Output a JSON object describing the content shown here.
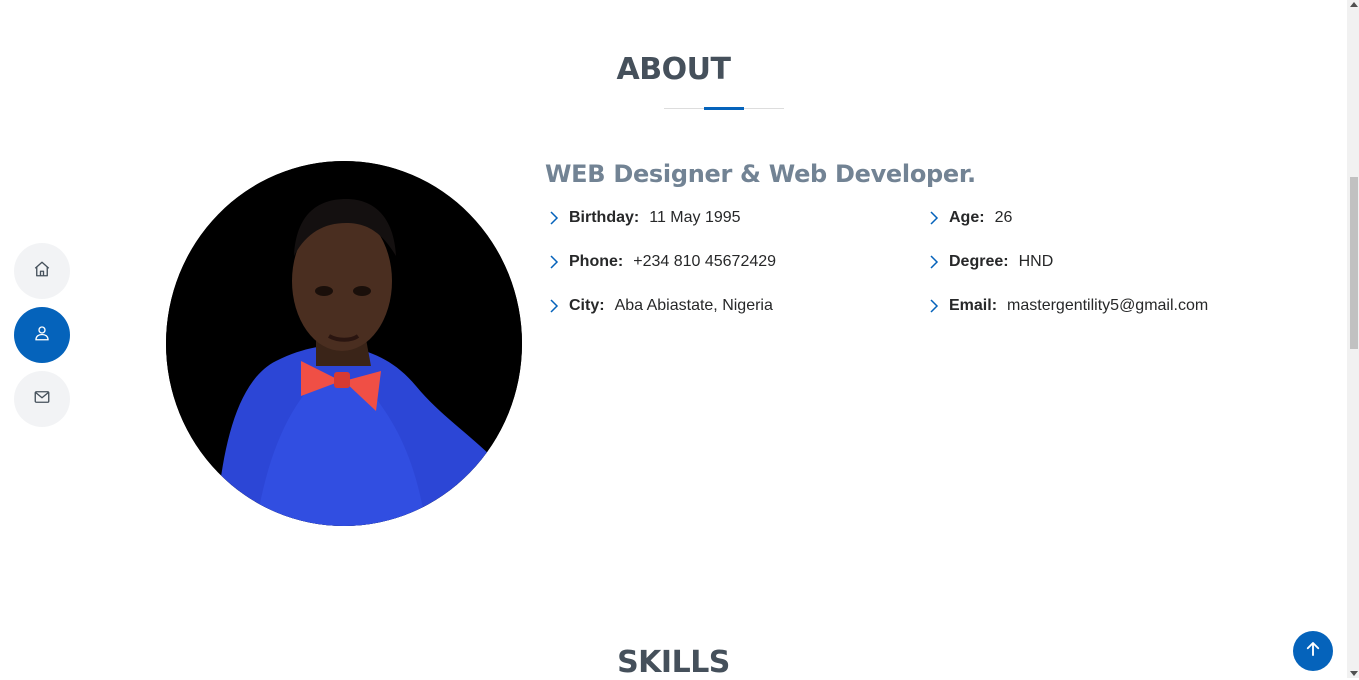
{
  "nav": {
    "items": [
      {
        "name": "home",
        "icon": "house-icon",
        "active": false
      },
      {
        "name": "about",
        "icon": "person-icon",
        "active": true
      },
      {
        "name": "contact",
        "icon": "envelope-icon",
        "active": false
      }
    ]
  },
  "about": {
    "title": "ABOUT",
    "role": "WEB Designer & Web Developer.",
    "details": {
      "birthday": {
        "label": "Birthday:",
        "value": "11 May 1995"
      },
      "phone": {
        "label": "Phone:",
        "value": "+234 810 45672429"
      },
      "city": {
        "label": "City:",
        "value": "Aba Abiastate, Nigeria"
      },
      "age": {
        "label": "Age:",
        "value": "26"
      },
      "degree": {
        "label": "Degree:",
        "value": "HND"
      },
      "email": {
        "label": "Email:",
        "value": "mastergentility5@gmail.com"
      }
    }
  },
  "skills": {
    "title": "SKILLS"
  },
  "back_to_top": {
    "icon": "arrow-up-icon"
  },
  "colors": {
    "accent": "#0563bb",
    "heading": "#45505b",
    "role": "#728394",
    "nav_bg": "#f2f3f5"
  }
}
